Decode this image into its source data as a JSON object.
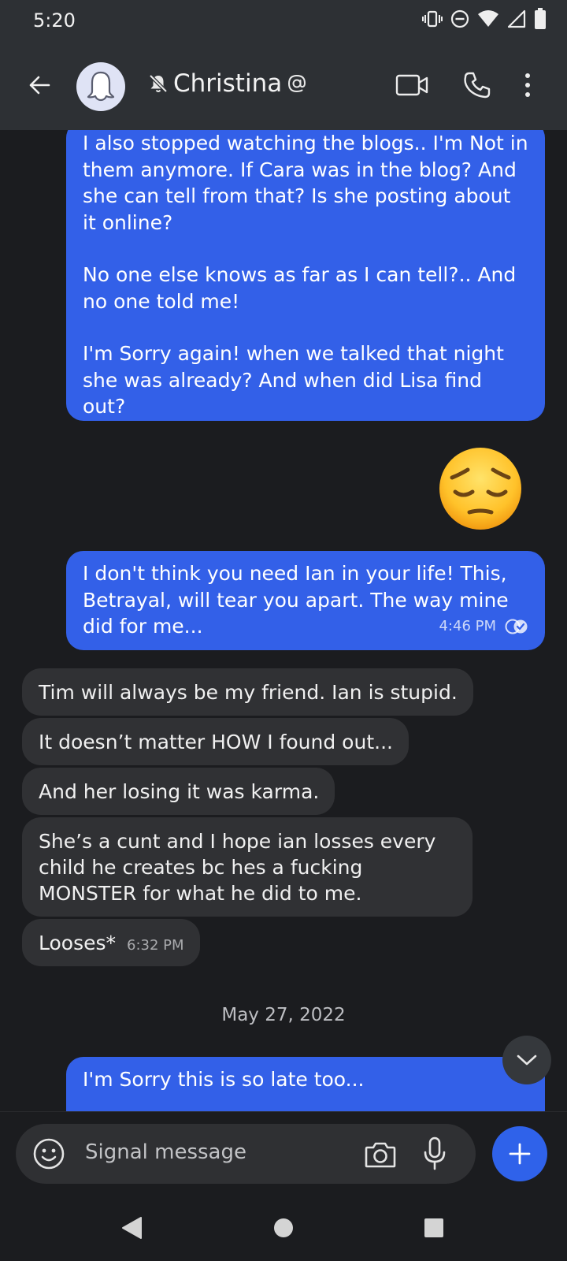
{
  "status_bar": {
    "time": "5:20"
  },
  "header": {
    "contact_name": "Christina"
  },
  "messages": {
    "out1": {
      "p1": "I also stopped watching the blogs.. I'm Not in them anymore. If Cara was in the blog? And she can tell from that? Is she posting about it online?",
      "p2": "No one else knows as far as I can tell?.. And no one told me!",
      "p3": "I'm Sorry again! when we talked that night she was already? And when did Lisa find out?"
    },
    "emoji": "pensive-face",
    "out2": {
      "text": "I don't think you need Ian in your life! This, Betrayal, will tear you apart. The way mine did for me...",
      "time": "4:46 PM"
    },
    "in1": "Tim will always be my friend. Ian is stupid.",
    "in2": "It doesn’t matter HOW I found out...",
    "in3": "And her losing it was karma.",
    "in4": "She’s a cunt and I hope ian losses every child he creates bc hes a fucking MONSTER for what he did to me.",
    "in5": {
      "text": "Looses*",
      "time": "6:32 PM"
    },
    "date_separator": "May 27, 2022",
    "out3": "I'm Sorry this is so late too..."
  },
  "composer": {
    "placeholder": "Signal message"
  },
  "colors": {
    "outgoing_bubble": "#3360e8",
    "incoming_bubble": "#303134",
    "background": "#1b1c1f",
    "header": "#2d3034",
    "accent": "#2f62ea"
  }
}
